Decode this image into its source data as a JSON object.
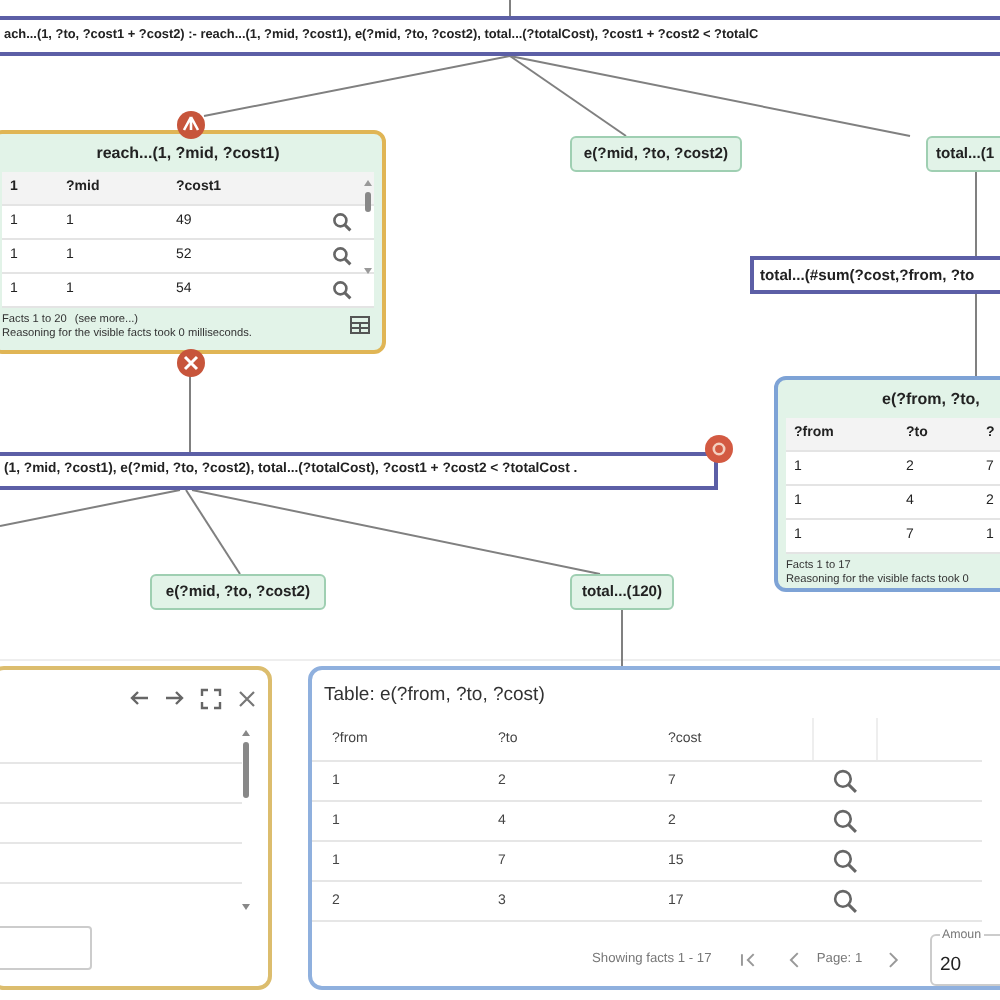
{
  "rules": [
    {
      "text": "ach...(1, ?to, ?cost1 + ?cost2) :- reach...(1, ?mid, ?cost1), e(?mid, ?to, ?cost2), total...(?totalCost), ?cost1 + ?cost2 < ?totalC"
    },
    {
      "text": "total...(#sum(?cost,?from, ?to"
    },
    {
      "text": "(1, ?mid, ?cost1), e(?mid, ?to, ?cost2), total...(?totalCost), ?cost1 + ?cost2 < ?totalCost ."
    }
  ],
  "atoms": [
    {
      "text": "e(?mid, ?to, ?cost2)"
    },
    {
      "text": "total...(1"
    },
    {
      "text": "e(?mid, ?to, ?cost2)"
    },
    {
      "text": "total...(120)"
    }
  ],
  "fact_cards": [
    {
      "title": "reach...(1, ?mid, ?cost1)",
      "selected": true,
      "columns": [
        "1",
        "?mid",
        "?cost1"
      ],
      "rows": [
        [
          "1",
          "1",
          "49"
        ],
        [
          "1",
          "1",
          "52"
        ],
        [
          "1",
          "1",
          "54"
        ]
      ],
      "inspect_buttons": true,
      "footer": "Facts 1 to 20",
      "link": "(see more...)",
      "note": "Reasoning for the visible facts took 0 milliseconds.",
      "grid_button": true
    },
    {
      "title": "e(?from, ?to,",
      "selected": false,
      "columns": [
        "?from",
        "?to",
        "?"
      ],
      "rows": [
        [
          "1",
          "2",
          "7"
        ],
        [
          "1",
          "4",
          "2"
        ],
        [
          "1",
          "7",
          "1"
        ]
      ],
      "footer": "Facts 1 to 17",
      "note": "Reasoning for the visible facts took 0"
    }
  ],
  "panels": [
    {
      "kind": "list",
      "selected": true
    },
    {
      "kind": "table",
      "selected": false,
      "title": "Table: e(?from, ?to, ?cost)",
      "columns": [
        "?from",
        "?to",
        "?cost"
      ],
      "rows": [
        [
          "1",
          "2",
          "7"
        ],
        [
          "1",
          "4",
          "2"
        ],
        [
          "1",
          "7",
          "15"
        ],
        [
          "2",
          "3",
          "17"
        ]
      ],
      "status": "Showing facts 1 - 17",
      "page": "Page: 1",
      "amount_label": "Amoun",
      "amount": "20"
    }
  ]
}
